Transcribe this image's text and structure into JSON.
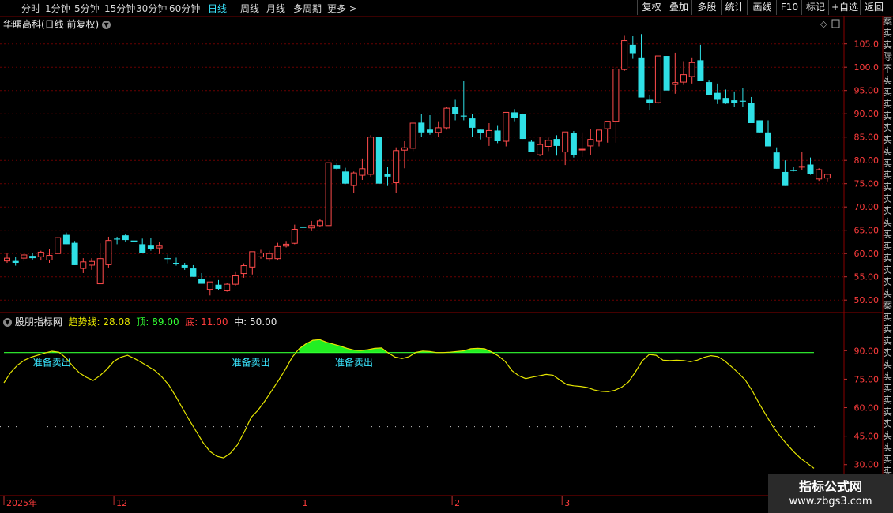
{
  "toolbar": {
    "periods": [
      "分时",
      "1分钟",
      "5分钟",
      "15分钟",
      "30分钟",
      "60分钟",
      "日线",
      "周线",
      "月线",
      "多周期",
      "更多 >"
    ],
    "active_period": "日线",
    "right_buttons": [
      "复权",
      "叠加",
      "多股",
      "统计",
      "画线",
      "F10",
      "标记",
      "+自选",
      "返回"
    ]
  },
  "main_panel": {
    "title": "华曙高科(日线 前复权)"
  },
  "indicator": {
    "name": "股朋指标网",
    "trend_label": "趋势线:",
    "trend_value": "28.08",
    "top_label": "顶:",
    "top_value": "89.00",
    "bottom_label": "底:",
    "bottom_value": "11.00",
    "mid_label": "中:",
    "mid_value": "50.00",
    "signal_text": "准备卖出"
  },
  "colors": {
    "up": "#ff4b4b",
    "down": "#2fe0e6",
    "trend_line": "#e6e600",
    "top_line": "#33ff33",
    "signal": "#3ae6ff",
    "axis_text": "#ff3c3c",
    "grid": "#6b0000"
  },
  "watermark": {
    "title": "指标公式网",
    "url": "www.zbgs3.com"
  },
  "side_strip_text": "案实实际不实实实实实实实实实实实实实实实实实实实案实实实实实实实实实实实实实实实实",
  "chart_data": [
    {
      "type": "candlestick",
      "title": "华曙高科(日线 前复权)",
      "ylim": [
        48,
        108
      ],
      "y_ticks": [
        50,
        55,
        60,
        65,
        70,
        75,
        80,
        85,
        90,
        95,
        100,
        105
      ],
      "y_tick_labels": [
        "50.00",
        "55.00",
        "60.00",
        "65.00",
        "70.00",
        "75.00",
        "80.00",
        "85.00",
        "90.00",
        "95.00",
        "100.0",
        "105.0"
      ],
      "x_labels": [
        "2025年",
        "12",
        "1",
        "2",
        "3"
      ],
      "x_label_index": [
        0,
        13,
        35,
        53,
        66
      ],
      "ohlc": [
        [
          58.4,
          60.2,
          58.0,
          59.0
        ],
        [
          58.4,
          59.3,
          57.4,
          58.0
        ],
        [
          59.0,
          60.0,
          58.4,
          59.7
        ],
        [
          59.5,
          60.2,
          58.7,
          59.0
        ],
        [
          59.3,
          60.6,
          58.5,
          60.3
        ],
        [
          58.6,
          60.9,
          58.0,
          59.6
        ],
        [
          60.0,
          63.5,
          59.9,
          63.4
        ],
        [
          64.0,
          64.5,
          62.0,
          62.0
        ],
        [
          62.3,
          62.7,
          57.5,
          57.5
        ],
        [
          56.8,
          59.0,
          55.8,
          58.2
        ],
        [
          57.5,
          59.0,
          56.5,
          58.3
        ],
        [
          53.5,
          62.2,
          54.6,
          58.9
        ],
        [
          57.6,
          63.6,
          57.0,
          62.8
        ],
        [
          63.2,
          63.6,
          62.0,
          63.0
        ],
        [
          63.9,
          64.1,
          62.5,
          62.9
        ],
        [
          62.8,
          64.6,
          61.0,
          62.5
        ],
        [
          62.0,
          63.2,
          60.2,
          60.2
        ],
        [
          61.7,
          63.4,
          60.6,
          61.0
        ],
        [
          61.2,
          62.5,
          59.9,
          61.6
        ],
        [
          59.0,
          59.8,
          57.9,
          58.8
        ],
        [
          58.0,
          59.1,
          57.4,
          57.9
        ],
        [
          57.5,
          58.0,
          56.5,
          57.0
        ],
        [
          56.8,
          57.5,
          55.0,
          55.0
        ],
        [
          54.6,
          55.8,
          53.5,
          53.5
        ],
        [
          52.3,
          53.9,
          51.0,
          53.9
        ],
        [
          53.3,
          54.3,
          52.1,
          52.4
        ],
        [
          52.0,
          53.6,
          51.8,
          53.4
        ],
        [
          53.4,
          56.0,
          53.1,
          55.2
        ],
        [
          55.7,
          57.9,
          54.8,
          57.4
        ],
        [
          57.1,
          60.4,
          55.5,
          60.4
        ],
        [
          59.3,
          60.8,
          58.9,
          60.1
        ],
        [
          58.9,
          60.6,
          58.3,
          60.0
        ],
        [
          58.9,
          62.3,
          58.5,
          61.5
        ],
        [
          61.6,
          62.7,
          61.3,
          62.0
        ],
        [
          62.2,
          66.2,
          62.0,
          65.2
        ],
        [
          65.8,
          67.0,
          65.0,
          65.5
        ],
        [
          65.5,
          67.0,
          64.8,
          66.0
        ],
        [
          66.0,
          67.5,
          65.7,
          67.0
        ],
        [
          66.0,
          79.5,
          66.0,
          79.5
        ],
        [
          79.0,
          79.5,
          78.0,
          78.2
        ],
        [
          77.6,
          78.4,
          74.9,
          75.0
        ],
        [
          74.6,
          77.6,
          73.0,
          77.3
        ],
        [
          76.8,
          80.4,
          75.8,
          78.2
        ],
        [
          77.0,
          85.4,
          76.5,
          85.0
        ],
        [
          85.0,
          85.0,
          75.0,
          75.0
        ],
        [
          77.0,
          78.5,
          74.5,
          76.5
        ],
        [
          75.2,
          82.8,
          73.0,
          82.1
        ],
        [
          82.2,
          84.1,
          78.3,
          82.7
        ],
        [
          82.6,
          88.0,
          82.0,
          88.0
        ],
        [
          88.1,
          89.9,
          85.0,
          86.0
        ],
        [
          86.6,
          89.7,
          85.5,
          86.0
        ],
        [
          86.0,
          88.4,
          85.1,
          87.0
        ],
        [
          87.0,
          91.4,
          86.6,
          91.2
        ],
        [
          91.5,
          93.0,
          88.6,
          90.0
        ],
        [
          89.6,
          97.0,
          88.6,
          89.4
        ],
        [
          89.0,
          90.0,
          85.1,
          87.0
        ],
        [
          86.6,
          86.6,
          84.5,
          85.8
        ],
        [
          85.0,
          88.0,
          83.1,
          86.4
        ],
        [
          86.4,
          87.4,
          83.7,
          84.1
        ],
        [
          84.1,
          89.8,
          83.0,
          90.3
        ],
        [
          90.3,
          91.0,
          88.4,
          89.1
        ],
        [
          89.9,
          90.0,
          84.6,
          84.6
        ],
        [
          84.0,
          84.3,
          81.8,
          81.8
        ],
        [
          81.2,
          85.1,
          80.9,
          83.4
        ],
        [
          83.0,
          84.9,
          82.0,
          84.3
        ],
        [
          84.6,
          85.4,
          81.0,
          83.1
        ],
        [
          81.8,
          85.7,
          79.0,
          86.1
        ],
        [
          85.8,
          86.3,
          80.6,
          81.1
        ],
        [
          82.3,
          86.0,
          80.7,
          82.4
        ],
        [
          83.1,
          86.8,
          81.1,
          84.5
        ],
        [
          84.1,
          85.2,
          83.0,
          86.5
        ],
        [
          86.8,
          88.3,
          83.8,
          88.4
        ],
        [
          88.4,
          100.0,
          83.8,
          99.6
        ],
        [
          99.5,
          106.9,
          99.2,
          105.7
        ],
        [
          104.8,
          106.7,
          101.8,
          103.0
        ],
        [
          102.1,
          107.1,
          100.1,
          93.5
        ],
        [
          93.0,
          94.0,
          90.7,
          92.3
        ],
        [
          92.4,
          98.5,
          92.2,
          102.4
        ],
        [
          102.4,
          102.4,
          98.5,
          95.0
        ],
        [
          96.3,
          103.1,
          94.3,
          96.7
        ],
        [
          96.8,
          101.3,
          96.2,
          98.4
        ],
        [
          98.0,
          102.1,
          96.5,
          101.0
        ],
        [
          101.5,
          104.8,
          97.0,
          97.0
        ],
        [
          96.8,
          97.3,
          94.0,
          94.0
        ],
        [
          94.5,
          96.5,
          92.1,
          93.0
        ],
        [
          93.4,
          95.2,
          92.1,
          92.2
        ],
        [
          92.9,
          94.8,
          91.4,
          92.3
        ],
        [
          92.8,
          95.6,
          91.5,
          92.6
        ],
        [
          92.4,
          93.6,
          88.0,
          88.0
        ],
        [
          88.6,
          88.6,
          86.0,
          86.0
        ],
        [
          86.0,
          88.6,
          85.5,
          83.0
        ],
        [
          81.7,
          82.8,
          78.2,
          78.2
        ],
        [
          77.5,
          80.0,
          74.5,
          74.5
        ],
        [
          77.9,
          78.6,
          77.6,
          77.7
        ],
        [
          78.7,
          81.8,
          77.9,
          78.7
        ],
        [
          79.1,
          80.6,
          76.9,
          77.0
        ],
        [
          76.0,
          78.3,
          75.6,
          78.0
        ],
        [
          76.2,
          77.1,
          75.5,
          77.0
        ]
      ]
    },
    {
      "type": "area-line",
      "name": "股朋指标网",
      "ylim": [
        22,
        103
      ],
      "y_ticks": [
        30,
        45,
        60,
        75,
        90
      ],
      "y_tick_labels": [
        "30.00",
        "45.00",
        "60.00",
        "75.00",
        "90.00"
      ],
      "top": 89.0,
      "bottom": 11.0,
      "mid": 50.0,
      "trend": [
        73.1,
        78.6,
        82.5,
        85.0,
        86.6,
        87.7,
        88.8,
        89.7,
        89.2,
        86.3,
        82.0,
        78.3,
        76.0,
        74.3,
        76.9,
        80.2,
        84.4,
        86.5,
        87.6,
        85.9,
        83.9,
        81.7,
        79.5,
        76.2,
        72.0,
        66.1,
        59.8,
        53.5,
        47.6,
        41.6,
        37.0,
        34.4,
        33.6,
        36.1,
        40.3,
        47.1,
        54.8,
        58.6,
        63.5,
        68.9,
        74.4,
        80.1,
        86.6,
        91.0,
        93.6,
        95.5,
        95.8,
        94.4,
        93.4,
        92.4,
        91.2,
        90.3,
        90.1,
        90.5,
        91.2,
        91.4,
        88.8,
        86.6,
        85.9,
        86.8,
        89.1,
        89.8,
        89.6,
        89.0,
        89.0,
        89.2,
        89.6,
        89.9,
        91.0,
        91.2,
        91.0,
        89.4,
        87.3,
        84.4,
        79.5,
        76.8,
        75.3,
        76.1,
        76.8,
        77.5,
        77.1,
        74.5,
        72.1,
        71.5,
        71.2,
        70.6,
        69.3,
        68.6,
        68.4,
        69.2,
        70.8,
        73.6,
        78.9,
        84.7,
        88.0,
        87.6,
        85.0,
        84.8,
        85.0,
        84.8,
        84.2,
        85.0,
        86.5,
        87.4,
        86.9,
        84.6,
        81.5,
        78.2,
        74.5,
        69.0,
        62.3,
        56.2,
        50.2,
        45.2,
        41.0,
        37.0,
        33.5,
        30.8,
        28.08
      ],
      "signal_index": [
        4,
        33,
        48
      ]
    }
  ]
}
